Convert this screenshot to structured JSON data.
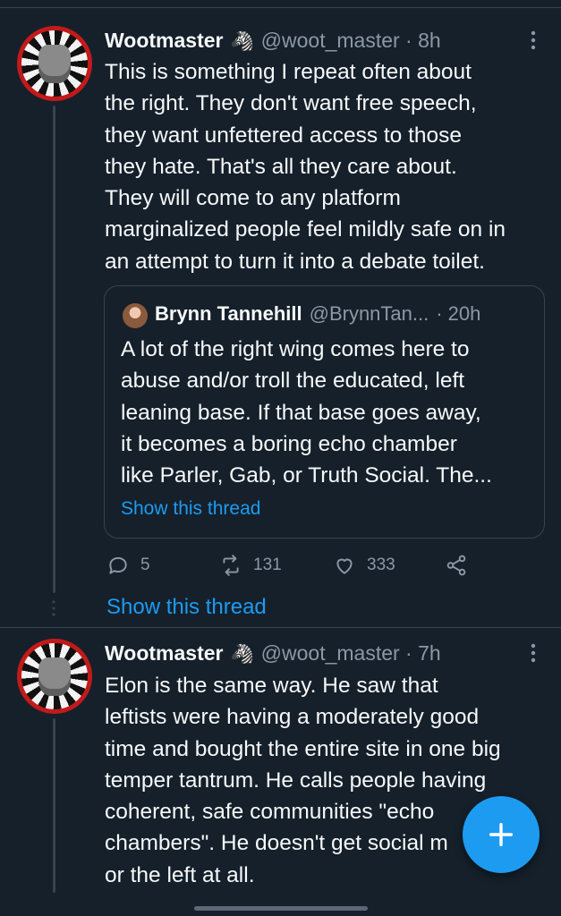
{
  "tweet1": {
    "name": "Wootmaster",
    "badge": "🦓",
    "handle_time": "@woot_master · 8h",
    "text": "This is something I repeat often about\nthe right. They don't want free speech,\nthey want unfettered access to those\nthey hate. That's all they care about.\nThey will come to any platform\nmarginalized people feel mildly safe on in\nan attempt to turn it into a debate toilet.",
    "quote": {
      "name": "Brynn Tannehill",
      "handle": "@BrynnTan...",
      "time": "· 20h",
      "text": "A lot of the right wing comes here to\nabuse and/or troll the educated, left\nleaning base. If that base goes away,\nit becomes a boring echo chamber\nlike Parler, Gab, or Truth Social. The...",
      "show_thread": "Show this thread"
    },
    "actions": {
      "replies": "5",
      "retweets": "131",
      "likes": "333"
    }
  },
  "show_thread": "Show this thread",
  "tweet2": {
    "name": "Wootmaster",
    "badge": "🦓",
    "handle_time": "@woot_master · 7h",
    "text": "Elon is the same way. He saw that\nleftists were having a moderately good\ntime and bought the entire site in one big\ntemper tantrum. He calls people having\ncoherent, safe communities \"echo\nchambers\". He doesn't get social m\nor the left at all."
  },
  "colors": {
    "background": "#15202b",
    "accent": "#1d9bf0",
    "muted": "#8b98a5",
    "border": "#38444d"
  },
  "icons": {
    "reply": "speech-bubble-icon",
    "retweet": "retweet-arrows-icon",
    "like": "heart-icon",
    "share": "share-nodes-icon",
    "compose": "plus-icon",
    "more": "more-vertical-icon"
  }
}
